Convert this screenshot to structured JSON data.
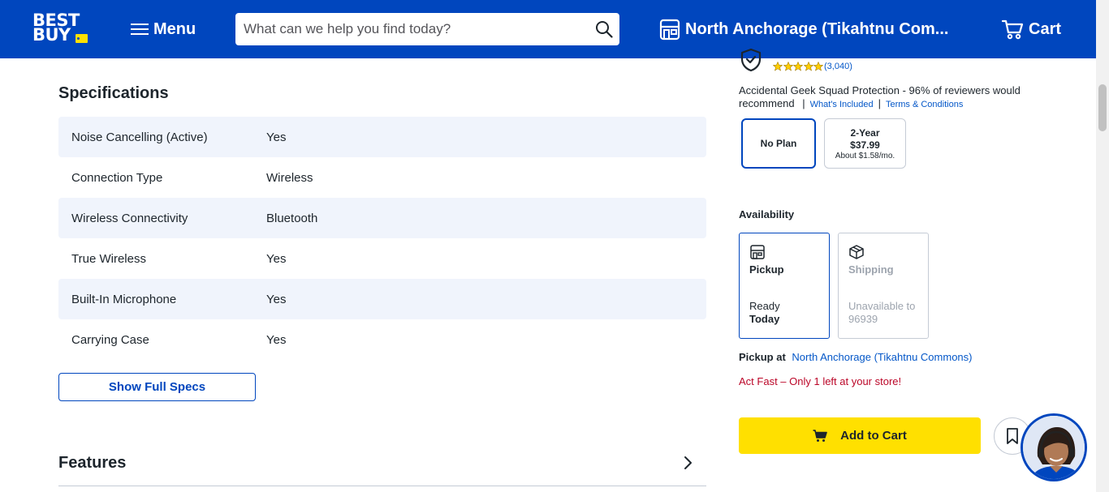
{
  "header": {
    "logo_line1": "BEST",
    "logo_line2": "BUY",
    "menu_label": "Menu",
    "search_placeholder": "What can we help you find today?",
    "store_label": "North Anchorage (Tikahtnu Com...",
    "cart_label": "Cart"
  },
  "specs": {
    "title": "Specifications",
    "rows": [
      {
        "label": "Noise Cancelling (Active)",
        "value": "Yes"
      },
      {
        "label": "Connection Type",
        "value": "Wireless"
      },
      {
        "label": "Wireless Connectivity",
        "value": "Bluetooth"
      },
      {
        "label": "True Wireless",
        "value": "Yes"
      },
      {
        "label": "Built-In Microphone",
        "value": "Yes"
      },
      {
        "label": "Carrying Case",
        "value": "Yes"
      }
    ],
    "show_full_label": "Show Full Specs"
  },
  "features": {
    "title": "Features"
  },
  "protection": {
    "rating_count": "(3,040)",
    "stars": 5,
    "description": "Accidental Geek Squad Protection - 96% of reviewers would recommend",
    "separator": "|",
    "whats_included": "What's Included",
    "terms": "Terms & Conditions",
    "plans": [
      {
        "title": "No Plan",
        "price": "",
        "monthly": ""
      },
      {
        "title": "2-Year",
        "price": "$37.99",
        "monthly": "About $1.58/mo."
      }
    ]
  },
  "availability": {
    "title": "Availability",
    "pickup": {
      "name": "Pickup",
      "status_line1": "Ready",
      "status_line2": "Today"
    },
    "shipping": {
      "name": "Shipping",
      "status_line1": "Unavailable to",
      "status_line2": "96939"
    },
    "pickup_at_label": "Pickup at",
    "pickup_store": "North Anchorage (Tikahtnu Commons)",
    "urgency": "Act Fast – Only 1 left at your store!"
  },
  "purchase": {
    "add_to_cart_label": "Add to Cart"
  },
  "colors": {
    "brand_blue": "#0046be",
    "brand_yellow": "#ffe000",
    "link_blue": "#0457c8",
    "alert_red": "#bb0628",
    "row_tint": "#f0f4fc"
  }
}
